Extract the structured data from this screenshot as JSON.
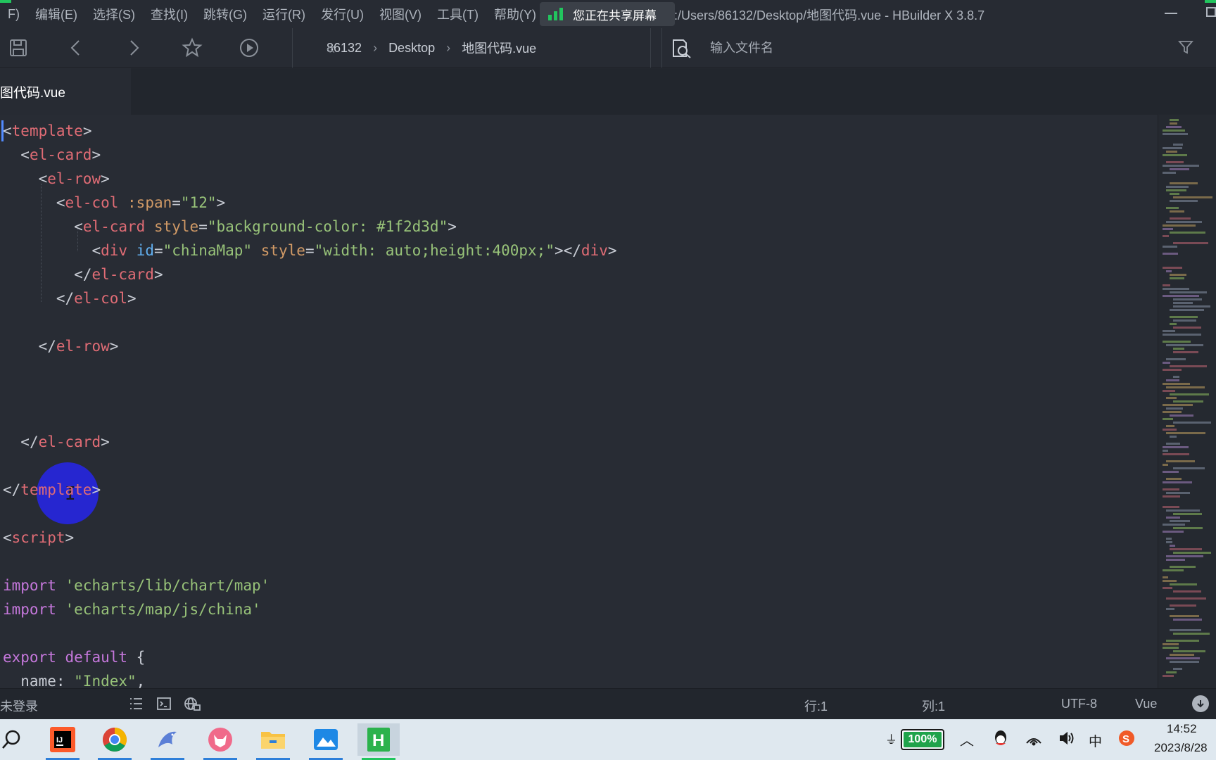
{
  "menubar": {
    "items": [
      "F)",
      "编辑(E)",
      "选择(S)",
      "查找(I)",
      "跳转(G)",
      "运行(R)",
      "发行(U)",
      "视图(V)",
      "工具(T)",
      "帮助(Y)"
    ],
    "share_text": "您正在共享屏幕",
    "window_title": ":/Users/86132/Desktop/地图代码.vue - HBuilder X 3.8.7",
    "accent_color": "#22c55e"
  },
  "toolbar": {
    "icons": [
      "save-icon",
      "back-icon",
      "forward-icon",
      "star-icon",
      "run-icon"
    ],
    "breadcrumb": [
      "86132",
      "Desktop",
      "地图代码.vue"
    ],
    "search_placeholder": "输入文件名"
  },
  "tabs": {
    "active": "图代码.vue"
  },
  "editor": {
    "lines": [
      [
        [
          "t-punc",
          "<"
        ],
        [
          "t-tag",
          "template"
        ],
        [
          "t-punc",
          ">"
        ]
      ],
      [
        [
          "t-plain",
          "  "
        ],
        [
          "t-punc",
          "<"
        ],
        [
          "t-tag",
          "el-card"
        ],
        [
          "t-punc",
          ">"
        ]
      ],
      [
        [
          "t-plain",
          "    "
        ],
        [
          "t-punc",
          "<"
        ],
        [
          "t-tag",
          "el-row"
        ],
        [
          "t-punc",
          ">"
        ]
      ],
      [
        [
          "t-plain",
          "      "
        ],
        [
          "t-punc",
          "<"
        ],
        [
          "t-tag",
          "el-col"
        ],
        [
          "t-plain",
          " "
        ],
        [
          "t-attr",
          ":span"
        ],
        [
          "t-punc",
          "="
        ],
        [
          "t-str",
          "\"12\""
        ],
        [
          "t-punc",
          ">"
        ]
      ],
      [
        [
          "t-plain",
          "        "
        ],
        [
          "t-punc",
          "<"
        ],
        [
          "t-tag",
          "el-card"
        ],
        [
          "t-plain",
          " "
        ],
        [
          "t-attr",
          "style"
        ],
        [
          "t-punc",
          "="
        ],
        [
          "t-str",
          "\"background-color: #1f2d3d\""
        ],
        [
          "t-punc",
          ">"
        ]
      ],
      [
        [
          "t-plain",
          "          "
        ],
        [
          "t-punc",
          "<"
        ],
        [
          "t-tag",
          "div"
        ],
        [
          "t-plain",
          " "
        ],
        [
          "t-attr-b",
          "id"
        ],
        [
          "t-punc",
          "="
        ],
        [
          "t-str",
          "\"chinaMap\""
        ],
        [
          "t-plain",
          " "
        ],
        [
          "t-attr",
          "style"
        ],
        [
          "t-punc",
          "="
        ],
        [
          "t-str",
          "\"width: auto;height:400px;\""
        ],
        [
          "t-punc",
          "></"
        ],
        [
          "t-tag",
          "div"
        ],
        [
          "t-punc",
          ">"
        ]
      ],
      [
        [
          "t-plain",
          "        "
        ],
        [
          "t-punc",
          "</"
        ],
        [
          "t-tag",
          "el-card"
        ],
        [
          "t-punc",
          ">"
        ]
      ],
      [
        [
          "t-plain",
          "      "
        ],
        [
          "t-punc",
          "</"
        ],
        [
          "t-tag",
          "el-col"
        ],
        [
          "t-punc",
          ">"
        ]
      ],
      [],
      [
        [
          "t-plain",
          "    "
        ],
        [
          "t-punc",
          "</"
        ],
        [
          "t-tag",
          "el-row"
        ],
        [
          "t-punc",
          ">"
        ]
      ],
      [],
      [],
      [],
      [
        [
          "t-plain",
          "  "
        ],
        [
          "t-punc",
          "</"
        ],
        [
          "t-tag",
          "el-card"
        ],
        [
          "t-punc",
          ">"
        ]
      ],
      [],
      [
        [
          "t-punc",
          "</"
        ],
        [
          "t-tag",
          "template"
        ],
        [
          "t-punc",
          ">"
        ]
      ],
      [],
      [
        [
          "t-punc",
          "<"
        ],
        [
          "t-tag",
          "script"
        ],
        [
          "t-punc",
          ">"
        ]
      ],
      [],
      [
        [
          "t-kw",
          "import"
        ],
        [
          "t-plain",
          " "
        ],
        [
          "t-str",
          "'echarts/lib/chart/map'"
        ]
      ],
      [
        [
          "t-kw",
          "import"
        ],
        [
          "t-plain",
          " "
        ],
        [
          "t-str",
          "'echarts/map/js/china'"
        ]
      ],
      [],
      [
        [
          "t-kw",
          "export"
        ],
        [
          "t-plain",
          " "
        ],
        [
          "t-kw",
          "default"
        ],
        [
          "t-plain",
          " {"
        ]
      ],
      [
        [
          "t-plain",
          "  name: "
        ],
        [
          "t-str",
          "\"Index\""
        ],
        [
          "t-plain",
          ","
        ]
      ]
    ]
  },
  "statusbar": {
    "login": "未登录",
    "row": "行:1",
    "col": "列:1",
    "encoding": "UTF-8",
    "language": "Vue"
  },
  "taskbar": {
    "apps": [
      "search-icon",
      "intellij-icon",
      "chrome-icon",
      "dolphin-icon",
      "fox-icon",
      "file-explorer-icon",
      "photos-icon",
      "hbuilder-icon"
    ],
    "battery": "100%",
    "ime": "中",
    "time": "14:52",
    "date": "2023/8/28"
  }
}
